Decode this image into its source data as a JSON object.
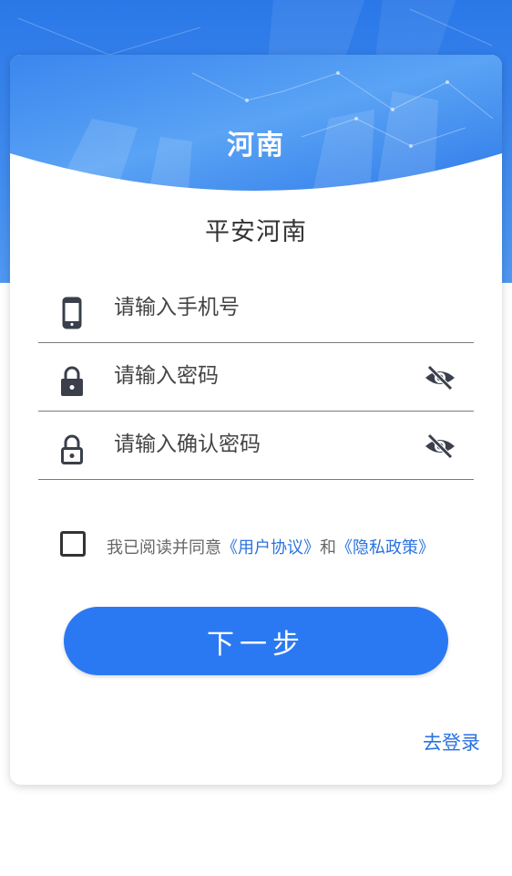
{
  "header": {
    "title": "河南"
  },
  "subtitle": "平安河南",
  "fields": [
    {
      "placeholder": "请输入手机号",
      "icon": "phone-icon"
    },
    {
      "placeholder": "请输入密码",
      "icon": "lock-icon",
      "toggle_icon": "eye-off-icon"
    },
    {
      "placeholder": "请输入确认密码",
      "icon": "lock-outline-icon",
      "toggle_icon": "eye-off-icon"
    }
  ],
  "agreement": {
    "prefix": "我已阅读并同意",
    "user_agreement": "《用户协议》",
    "and": "和",
    "privacy_policy": "《隐私政策》",
    "checked": false
  },
  "next_button": "下一步",
  "login_link": "去登录",
  "colors": {
    "primary": "#2b79f2",
    "link": "#2a72e0",
    "header_blue": "#3d8af0"
  }
}
